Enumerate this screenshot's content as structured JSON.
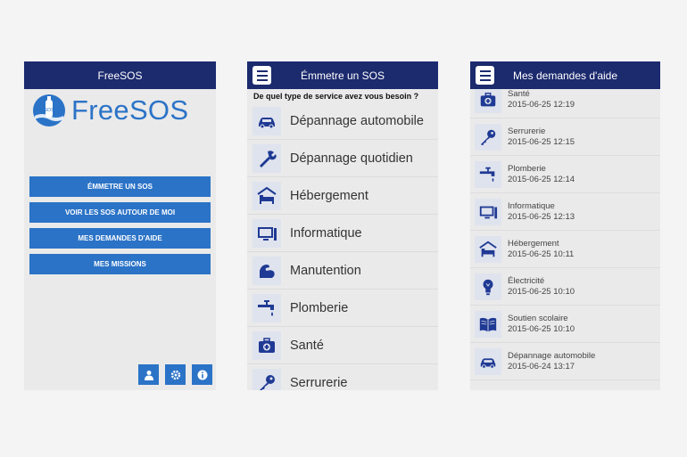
{
  "screen1": {
    "title": "FreeSOS",
    "logo_text": "FreeSOS",
    "buttons": [
      "ÉMMETRE UN SOS",
      "VOIR LES SOS AUTOUR DE MOI",
      "MES DEMANDES D'AIDE",
      "MES MISSIONS"
    ],
    "bottom_icons": [
      "user-icon",
      "gear-icon",
      "info-icon"
    ]
  },
  "screen2": {
    "title": "Émmetre un SOS",
    "question": "De quel type de service avez vous besoin ?",
    "services": [
      {
        "label": "Dépannage automobile",
        "icon": "car-icon"
      },
      {
        "label": "Dépannage quotidien",
        "icon": "tools-icon"
      },
      {
        "label": "Hébergement",
        "icon": "bed-icon"
      },
      {
        "label": "Informatique",
        "icon": "computer-icon"
      },
      {
        "label": "Manutention",
        "icon": "arm-icon"
      },
      {
        "label": "Plomberie",
        "icon": "faucet-icon"
      },
      {
        "label": "Santé",
        "icon": "medical-kit-icon"
      },
      {
        "label": "Serrurerie",
        "icon": "key-icon"
      }
    ]
  },
  "screen3": {
    "title": "Mes demandes d'aide",
    "requests": [
      {
        "category": "Santé",
        "date": "2015-06-25 12:19",
        "icon": "medical-kit-icon"
      },
      {
        "category": "Serrurerie",
        "date": "2015-06-25 12:15",
        "icon": "key-icon"
      },
      {
        "category": "Plomberie",
        "date": "2015-06-25 12:14",
        "icon": "faucet-icon"
      },
      {
        "category": "Informatique",
        "date": "2015-06-25 12:13",
        "icon": "computer-icon"
      },
      {
        "category": "Hébergement",
        "date": "2015-06-25 10:11",
        "icon": "bed-icon"
      },
      {
        "category": "Électricité",
        "date": "2015-06-25 10:10",
        "icon": "bulb-icon"
      },
      {
        "category": "Soutien scolaire",
        "date": "2015-06-25 10:10",
        "icon": "book-icon"
      },
      {
        "category": "Dépannage automobile",
        "date": "2015-06-24 13:17",
        "icon": "car-icon"
      }
    ]
  },
  "colors": {
    "appbar": "#1c2a6e",
    "accent": "#2b73c7",
    "icon_fill": "#1f3a94"
  }
}
